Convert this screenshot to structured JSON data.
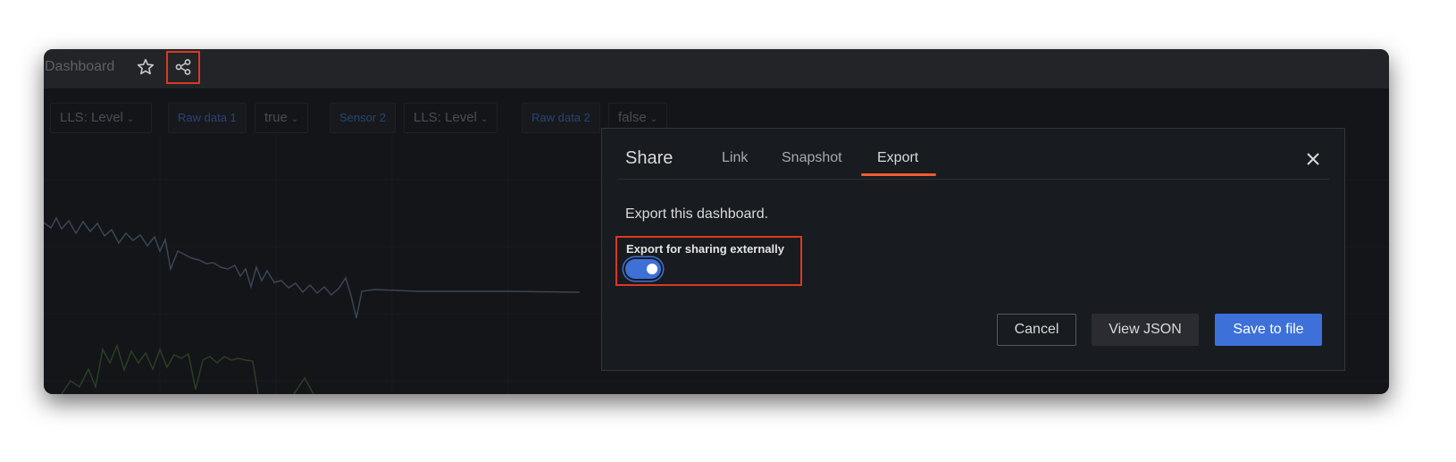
{
  "topbar": {
    "breadcrumb": "Dashboard",
    "star_icon": "star-icon",
    "share_icon": "share-icon"
  },
  "variables": [
    {
      "label": "",
      "value": "LLS: Level"
    },
    {
      "label": "Raw data 1",
      "value": "true"
    },
    {
      "label": "Sensor 2",
      "value": "LLS: Level"
    },
    {
      "label": "Raw data 2",
      "value": "false"
    }
  ],
  "share_modal": {
    "title": "Share",
    "tabs": [
      {
        "label": "Link",
        "active": false
      },
      {
        "label": "Snapshot",
        "active": false
      },
      {
        "label": "Export",
        "active": true
      }
    ],
    "description": "Export this dashboard.",
    "toggle": {
      "label": "Export for sharing externally",
      "checked": true
    },
    "buttons": {
      "cancel": "Cancel",
      "view_json": "View JSON",
      "save": "Save to file"
    }
  },
  "colors": {
    "accent": "#3d71d9",
    "active_tab": "#f15c2d",
    "highlight": "#d93921",
    "series_1": "#8da2bf",
    "series_2": "#6b9a4a"
  }
}
